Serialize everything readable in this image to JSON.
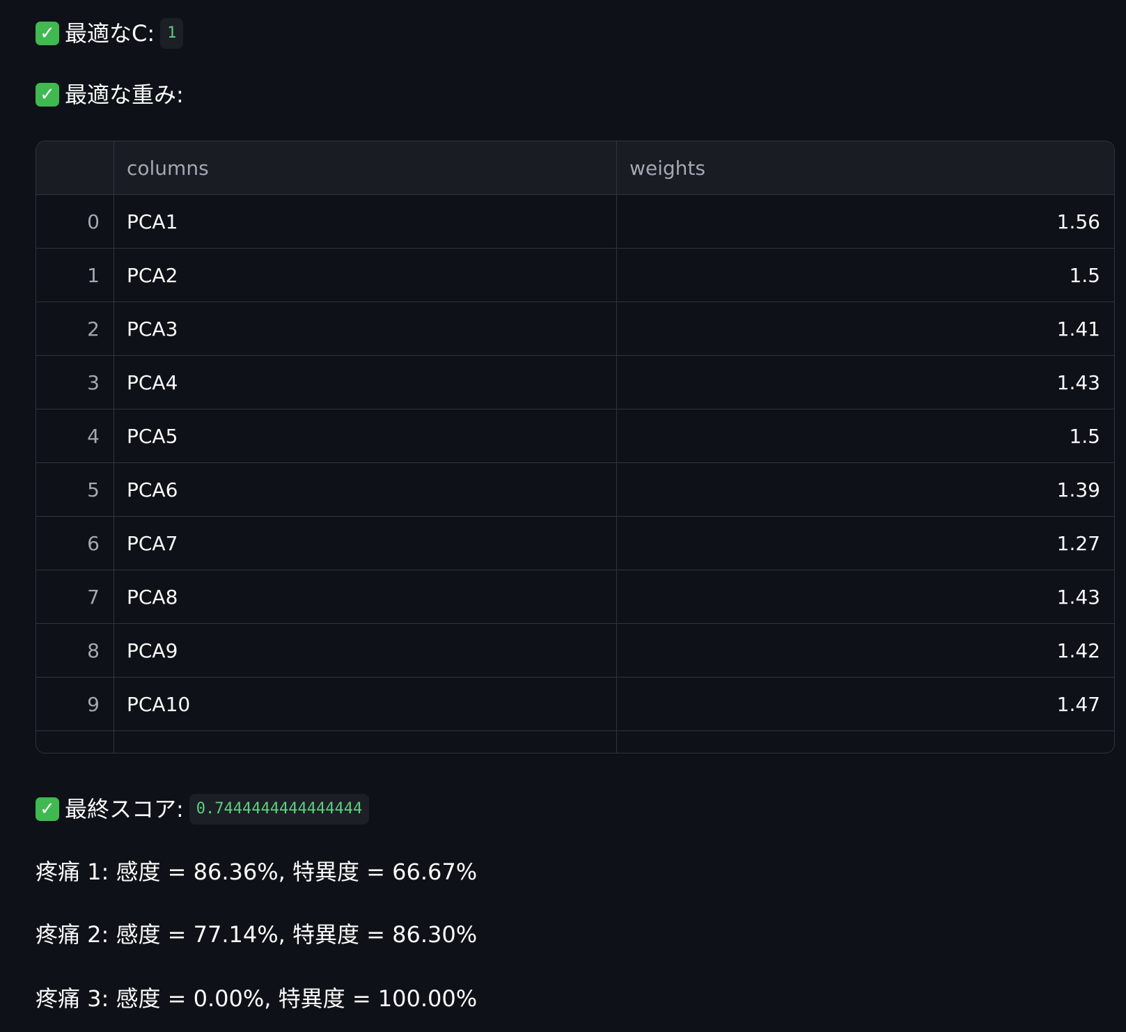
{
  "best_c": {
    "label": "最適なC:",
    "value": "1"
  },
  "best_weights": {
    "label": "最適な重み:"
  },
  "table": {
    "headers": {
      "index": "",
      "columns": "columns",
      "weights": "weights"
    },
    "rows": [
      {
        "index": "0",
        "column": "PCA1",
        "weight": "1.56"
      },
      {
        "index": "1",
        "column": "PCA2",
        "weight": "1.5"
      },
      {
        "index": "2",
        "column": "PCA3",
        "weight": "1.41"
      },
      {
        "index": "3",
        "column": "PCA4",
        "weight": "1.43"
      },
      {
        "index": "4",
        "column": "PCA5",
        "weight": "1.5"
      },
      {
        "index": "5",
        "column": "PCA6",
        "weight": "1.39"
      },
      {
        "index": "6",
        "column": "PCA7",
        "weight": "1.27"
      },
      {
        "index": "7",
        "column": "PCA8",
        "weight": "1.43"
      },
      {
        "index": "8",
        "column": "PCA9",
        "weight": "1.42"
      },
      {
        "index": "9",
        "column": "PCA10",
        "weight": "1.47"
      }
    ]
  },
  "final_score": {
    "label": "最終スコア:",
    "value": "0.7444444444444444"
  },
  "metrics": [
    "疼痛 1: 感度 = 86.36%, 特異度 = 66.67%",
    "疼痛 2: 感度 = 77.14%, 特異度 = 86.30%",
    "疼痛 3: 感度 = 0.00%, 特異度 = 100.00%"
  ],
  "icons": {
    "check": "check-mark-icon"
  },
  "colors": {
    "background": "#0e1117",
    "check_green": "#3fb950",
    "code_text": "#5ad37a"
  }
}
